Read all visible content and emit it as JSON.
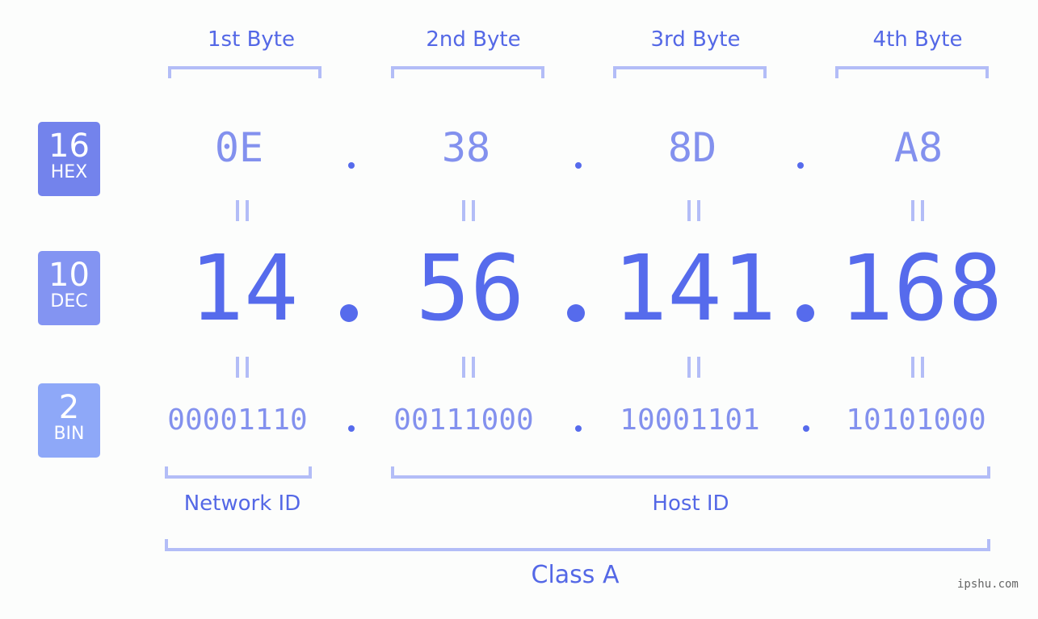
{
  "bytes": [
    {
      "header": "1st Byte",
      "hex": "0E",
      "dec": "14",
      "bin": "00001110"
    },
    {
      "header": "2nd Byte",
      "hex": "38",
      "dec": "56",
      "bin": "00111000"
    },
    {
      "header": "3rd Byte",
      "hex": "8D",
      "dec": "141",
      "bin": "10001101"
    },
    {
      "header": "4th Byte",
      "hex": "A8",
      "dec": "168",
      "bin": "10101000"
    }
  ],
  "badges": {
    "hex": {
      "num": "16",
      "label": "HEX",
      "color": "#7383ec"
    },
    "dec": {
      "num": "10",
      "label": "DEC",
      "color": "#8394f2"
    },
    "bin": {
      "num": "2",
      "label": "BIN",
      "color": "#8ea8f8"
    }
  },
  "segments": {
    "network": "Network ID",
    "host": "Host ID",
    "class": "Class A"
  },
  "colors": {
    "accent": "#566bec",
    "light": "#8391ee",
    "bracket": "#b3bdf7"
  },
  "watermark": "ipshu.com"
}
